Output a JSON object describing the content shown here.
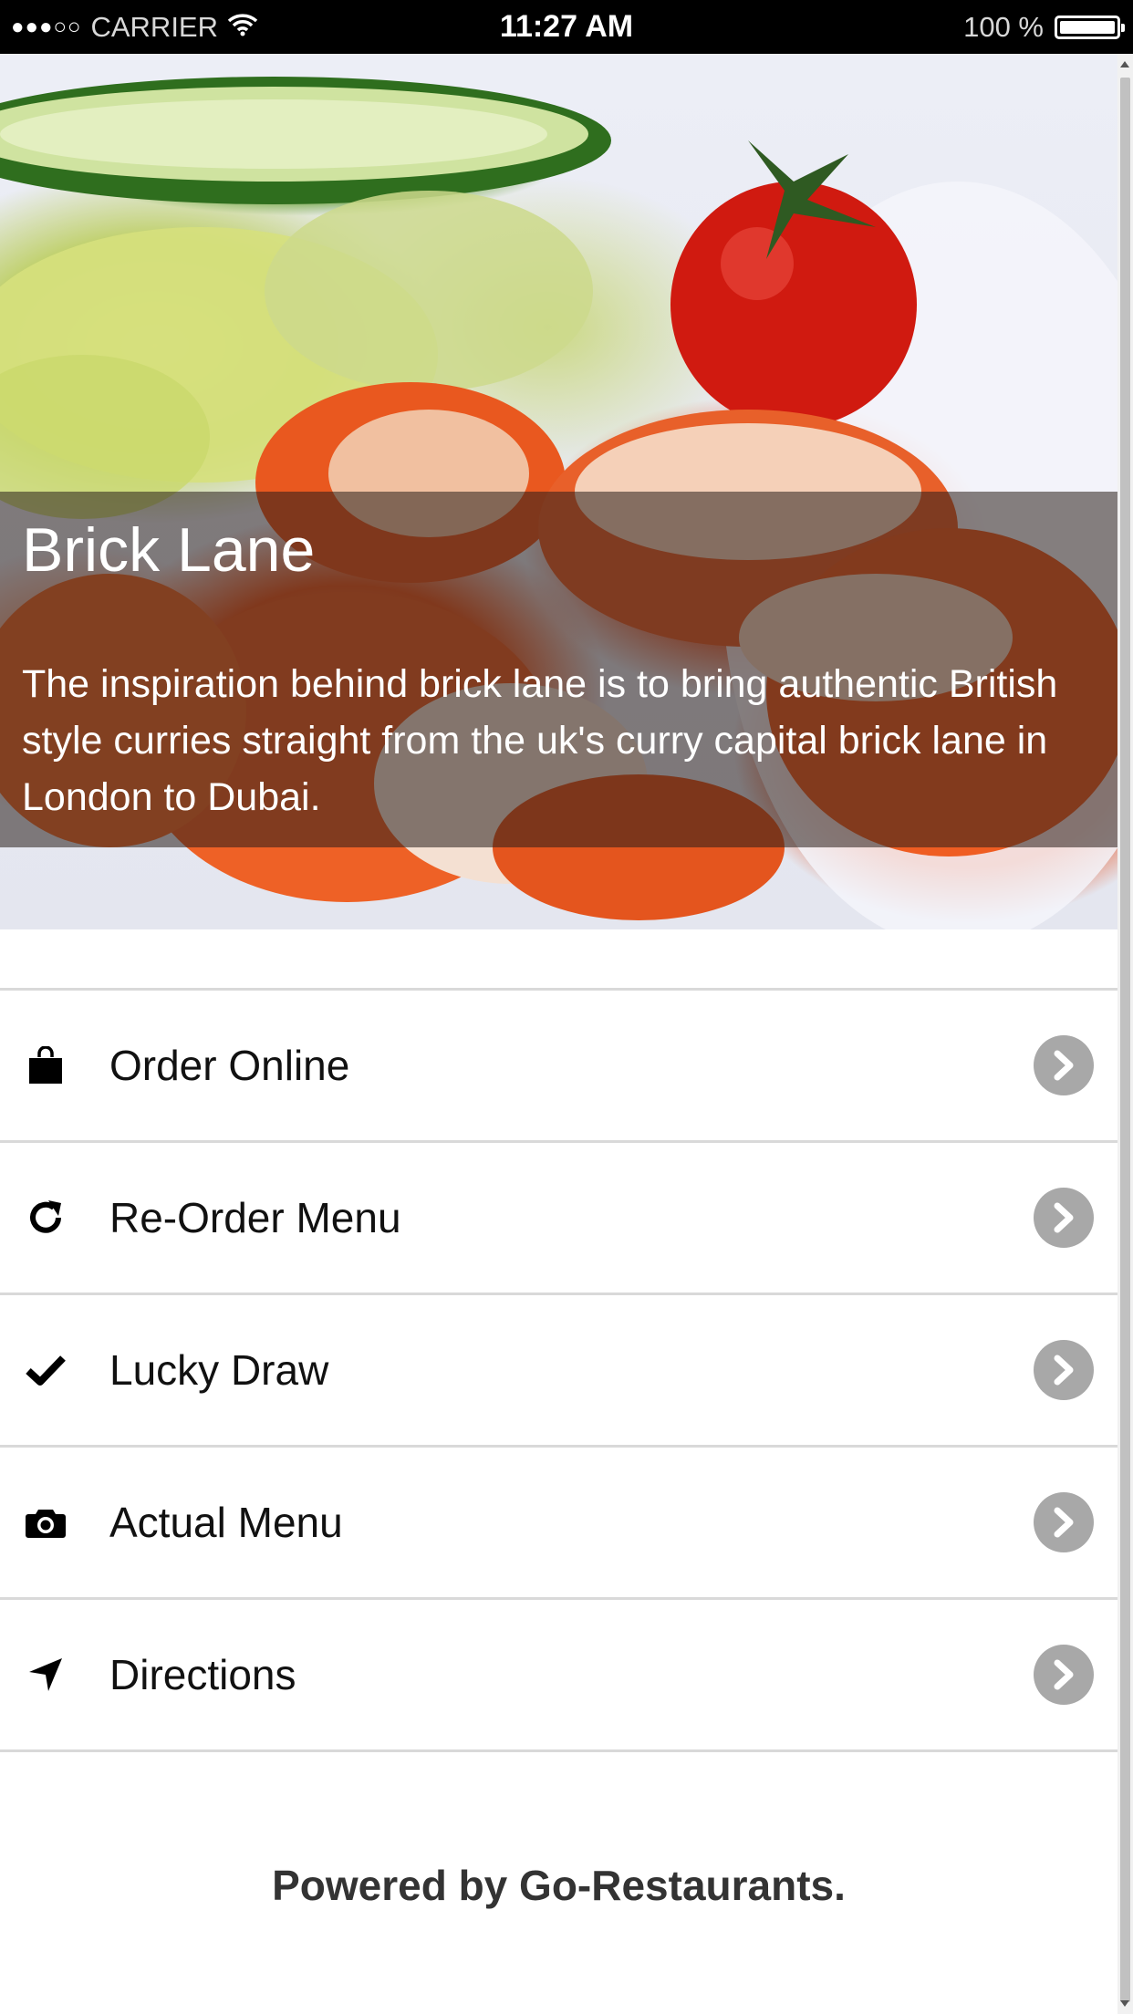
{
  "status_bar": {
    "signal_dots": "●●●○○",
    "carrier": "CARRIER",
    "time": "11:27 AM",
    "battery_text": "100 %",
    "icons": [
      "wifi-icon",
      "battery-icon"
    ]
  },
  "hero": {
    "title": "Brick Lane",
    "description": "The inspiration behind brick lane is to bring authentic British style curries straight from the uk's curry capital brick lane in London to Dubai."
  },
  "menu": {
    "items": [
      {
        "label": "Order Online",
        "icon": "shopping-bag-icon"
      },
      {
        "label": "Re-Order Menu",
        "icon": "refresh-icon"
      },
      {
        "label": "Lucky Draw",
        "icon": "checkmark-icon"
      },
      {
        "label": "Actual Menu",
        "icon": "camera-icon"
      },
      {
        "label": "Directions",
        "icon": "location-arrow-icon"
      }
    ],
    "chevron_icon": "chevron-right-icon"
  },
  "footer": {
    "text": "Powered by Go-Restaurants."
  },
  "colors": {
    "status_bar_bg": "#000000",
    "chevron_bg": "#a8a8a8",
    "divider": "#d9d9d9",
    "overlay": "rgba(40,30,25,0.55)"
  }
}
